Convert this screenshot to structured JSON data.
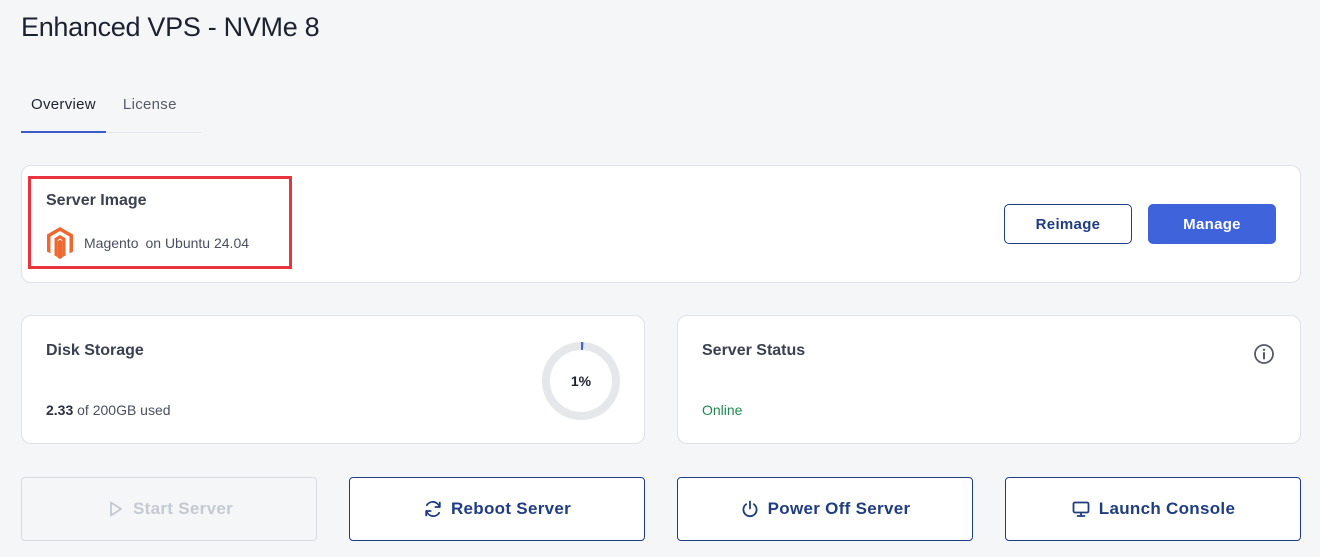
{
  "page": {
    "title": "Enhanced VPS - NVMe 8"
  },
  "tabs": [
    {
      "label": "Overview",
      "active": true
    },
    {
      "label": "License",
      "active": false
    }
  ],
  "server_image": {
    "title": "Server Image",
    "app": "Magento",
    "os": "on Ubuntu 24.04",
    "icon": "magento-icon",
    "reimage_label": "Reimage",
    "manage_label": "Manage"
  },
  "disk": {
    "title": "Disk Storage",
    "used": "2.33",
    "total_text": "of 200GB used",
    "percent_label": "1%",
    "percent": 1
  },
  "status": {
    "title": "Server Status",
    "value": "Online",
    "info_icon": "info-icon"
  },
  "actions": {
    "start": {
      "label": "Start Server",
      "icon": "play-icon",
      "disabled": true
    },
    "reboot": {
      "label": "Reboot Server",
      "icon": "refresh-icon"
    },
    "power_off": {
      "label": "Power Off Server",
      "icon": "power-icon"
    },
    "console": {
      "label": "Launch Console",
      "icon": "monitor-icon"
    }
  },
  "colors": {
    "primary": "#3f63db",
    "navy": "#1f3d80",
    "online": "#1e8a4c",
    "highlight": "#e8353d",
    "magento": "#ee672f"
  }
}
